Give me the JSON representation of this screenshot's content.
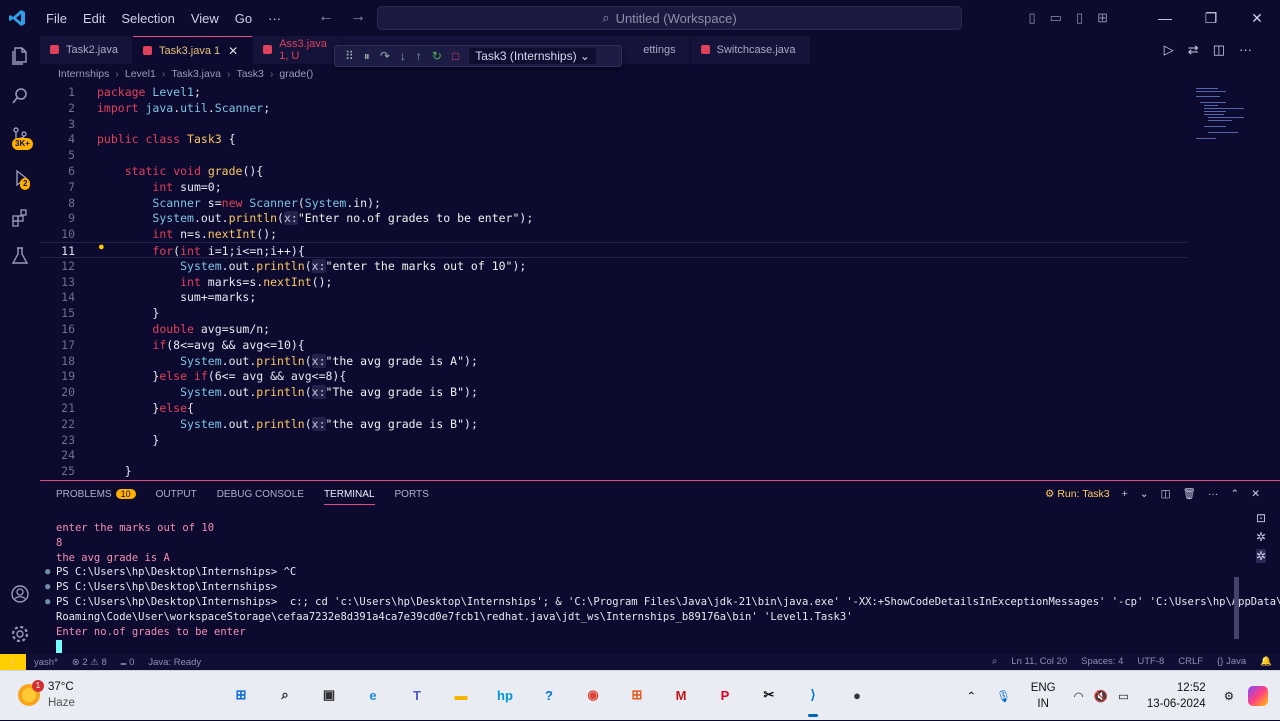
{
  "titlebar": {
    "menu": [
      "File",
      "Edit",
      "Selection",
      "View",
      "Go",
      "···"
    ],
    "search_text": "Untitled (Workspace)",
    "window_controls": [
      "—",
      "❐",
      "✕"
    ]
  },
  "activitybar": {
    "source_control_badge": "3K+",
    "run_badge": "2"
  },
  "tabs": [
    {
      "label": "Task2.java",
      "state": "normal"
    },
    {
      "label": "Task3.java 1",
      "state": "active"
    },
    {
      "label": "Ass3.java 1, U",
      "state": "error"
    },
    {
      "label": "ettings",
      "state": "normal"
    },
    {
      "label": "Switchcase.java",
      "state": "normal"
    }
  ],
  "debug_toolbar": {
    "config": "Task3 (Internships)"
  },
  "breadcrumb": [
    "Internships",
    "Level1",
    "Task3.java",
    "Task3",
    "grade()"
  ],
  "editor": {
    "current_line": 11,
    "lines": [
      {
        "n": "1",
        "code": "package Level1;"
      },
      {
        "n": "2",
        "code": "import java.util.Scanner;"
      },
      {
        "n": "3",
        "code": ""
      },
      {
        "n": "4",
        "code": "public class Task3 {"
      },
      {
        "n": "5",
        "code": ""
      },
      {
        "n": "6",
        "code": "    static void grade(){"
      },
      {
        "n": "7",
        "code": "        int sum=0;"
      },
      {
        "n": "8",
        "code": "        Scanner s=new Scanner(System.in);"
      },
      {
        "n": "9",
        "code": "        System.out.println(x:\"Enter no.of grades to be enter\");"
      },
      {
        "n": "10",
        "code": "        int n=s.nextInt();"
      },
      {
        "n": "11",
        "code": "        for(int i=1;i<=n;i++){"
      },
      {
        "n": "12",
        "code": "            System.out.println(x:\"enter the marks out of 10\");"
      },
      {
        "n": "13",
        "code": "            int marks=s.nextInt();"
      },
      {
        "n": "14",
        "code": "            sum+=marks;"
      },
      {
        "n": "15",
        "code": "        }"
      },
      {
        "n": "16",
        "code": "        double avg=sum/n;"
      },
      {
        "n": "17",
        "code": "        if(8<=avg && avg<=10){"
      },
      {
        "n": "18",
        "code": "            System.out.println(x:\"the avg grade is A\");"
      },
      {
        "n": "19",
        "code": "        }else if(6<= avg && avg<=8){"
      },
      {
        "n": "20",
        "code": "            System.out.println(x:\"The avg grade is B\");"
      },
      {
        "n": "21",
        "code": "        }else{"
      },
      {
        "n": "22",
        "code": "            System.out.println(x:\"the avg grade is B\");"
      },
      {
        "n": "23",
        "code": "        }"
      },
      {
        "n": "24",
        "code": ""
      },
      {
        "n": "25",
        "code": "    }"
      }
    ]
  },
  "panel": {
    "tabs": [
      "PROBLEMS",
      "OUTPUT",
      "DEBUG CONSOLE",
      "TERMINAL",
      "PORTS"
    ],
    "problems_count": "10",
    "active_tab": "TERMINAL",
    "run_label": "Run: Task3",
    "terminal_lines": [
      {
        "text": "enter the marks out of 10",
        "kind": "out",
        "dot": false
      },
      {
        "text": "8",
        "kind": "out",
        "dot": false
      },
      {
        "text": "the avg grade is A",
        "kind": "out",
        "dot": false
      },
      {
        "text": "PS C:\\Users\\hp\\Desktop\\Internships> ^C",
        "kind": "ps",
        "dot": true
      },
      {
        "text": "PS C:\\Users\\hp\\Desktop\\Internships>",
        "kind": "ps",
        "dot": true
      },
      {
        "text": "PS C:\\Users\\hp\\Desktop\\Internships>  c:; cd 'c:\\Users\\hp\\Desktop\\Internships'; & 'C:\\Program Files\\Java\\jdk-21\\bin\\java.exe' '-XX:+ShowCodeDetailsInExceptionMessages' '-cp' 'C:\\Users\\hp\\AppData\\",
        "kind": "ps",
        "dot": true
      },
      {
        "text": "Roaming\\Code\\User\\workspaceStorage\\cefaa7232e8d391a4ca7e39cd0e7fcb1\\redhat.java\\jdt_ws\\Internships_b89176a\\bin' 'Level1.Task3'",
        "kind": "ps",
        "dot": false
      },
      {
        "text": "Enter no.of grades to be enter",
        "kind": "out",
        "dot": false
      }
    ]
  },
  "statusbar": {
    "left": [
      "yash*",
      "⊗ 2 ⚠ 8",
      "⑉ 0",
      "Java: Ready"
    ],
    "right": [
      "Ln 11, Col 20",
      "Spaces: 4",
      "UTF-8",
      "CRLF",
      "{} Java"
    ]
  },
  "taskbar": {
    "weather_temp": "37°C",
    "weather_desc": "Haze",
    "weather_alert": "1",
    "lang_top": "ENG",
    "lang_bottom": "IN",
    "time": "12:52",
    "date": "13-06-2024",
    "apps": [
      {
        "name": "start",
        "glyph": "⊞",
        "color": "#0a6cd6"
      },
      {
        "name": "search",
        "glyph": "⌕",
        "color": "#222"
      },
      {
        "name": "task-view",
        "glyph": "▣",
        "color": "#333"
      },
      {
        "name": "edge",
        "glyph": "e",
        "color": "#1b8fd2"
      },
      {
        "name": "teams",
        "glyph": "T",
        "color": "#5059c9"
      },
      {
        "name": "file-explorer",
        "glyph": "▬",
        "color": "#f4b400"
      },
      {
        "name": "myhp",
        "glyph": "hp",
        "color": "#0096d6"
      },
      {
        "name": "help",
        "glyph": "?",
        "color": "#0078d4"
      },
      {
        "name": "chrome",
        "glyph": "◉",
        "color": "#db4437"
      },
      {
        "name": "store",
        "glyph": "⊞",
        "color": "#e25a1c"
      },
      {
        "name": "mcafee",
        "glyph": "M",
        "color": "#c01818"
      },
      {
        "name": "pinterest",
        "glyph": "P",
        "color": "#e60023"
      },
      {
        "name": "capcut",
        "glyph": "✂",
        "color": "#111"
      },
      {
        "name": "vscode",
        "glyph": "⟩",
        "color": "#0078d4"
      },
      {
        "name": "obs",
        "glyph": "●",
        "color": "#333"
      }
    ]
  }
}
